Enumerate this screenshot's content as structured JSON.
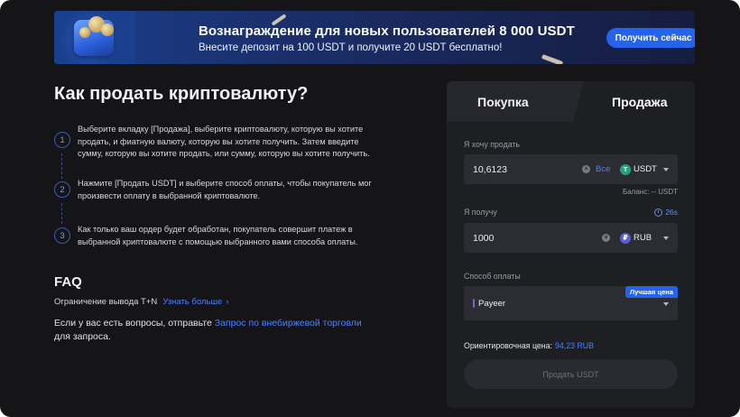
{
  "banner": {
    "title": "Вознаграждение для новых пользователей 8 000 USDT",
    "subtitle": "Внесите депозит на 100 USDT и получите 20 USDT бесплатно!",
    "cta": "Получить сейчас"
  },
  "guide": {
    "heading": "Как продать криптовалюту?",
    "steps": [
      {
        "num": "1",
        "text": "Выберите вкладку [Продажа], выберите криптовалюту, которую вы хотите продать, и фиатную валюту, которую вы хотите получить. Затем введите сумму, которую вы хотите продать, или сумму, которую вы хотите получить."
      },
      {
        "num": "2",
        "text": "Нажмите [Продать USDT] и выберите способ оплаты, чтобы покупатель мог произвести оплату в выбранной криптовалюте."
      },
      {
        "num": "3",
        "text": "Как только ваш ордер будет обработан, покупатель совершит платеж в выбранной криптовалюте с помощью выбранного вами способа оплаты."
      }
    ]
  },
  "faq": {
    "title": "FAQ",
    "item_text": "Ограничение вывода T+N",
    "item_link": "Узнать больше",
    "question_prefix": "Если у вас есть вопросы, отправьте",
    "question_link": "Запрос по внебиржевой торговли",
    "question_suffix": "для запроса."
  },
  "trade": {
    "tab_buy": "Покупка",
    "tab_sell": "Продажа",
    "sell_label": "Я хочу продать",
    "sell_amount": "10,6123",
    "sell_all": "Все",
    "sell_currency": "USDT",
    "balance": "Баланс: -- USDT",
    "receive_label": "Я получу",
    "timer": "26s",
    "receive_amount": "1000",
    "receive_currency": "RUB",
    "payment_label": "Способ оплаты",
    "payment_method": "Payeer",
    "payment_badge": "Лучшая цена",
    "estimate_label": "Ориентировочная цена:",
    "estimate_value": "94,23 RUB",
    "submit": "Продать USDT"
  },
  "colors": {
    "accent": "#2463eb",
    "link": "#4e7fff",
    "usdt": "#26a17b",
    "rub": "#5b5fd6",
    "payeer": "#8a62d8"
  },
  "icons": [
    "gift-coins-icon",
    "clear-icon",
    "usdt-coin-icon",
    "rub-coin-icon",
    "chevron-down-icon",
    "chevron-right-icon",
    "clock-icon"
  ]
}
